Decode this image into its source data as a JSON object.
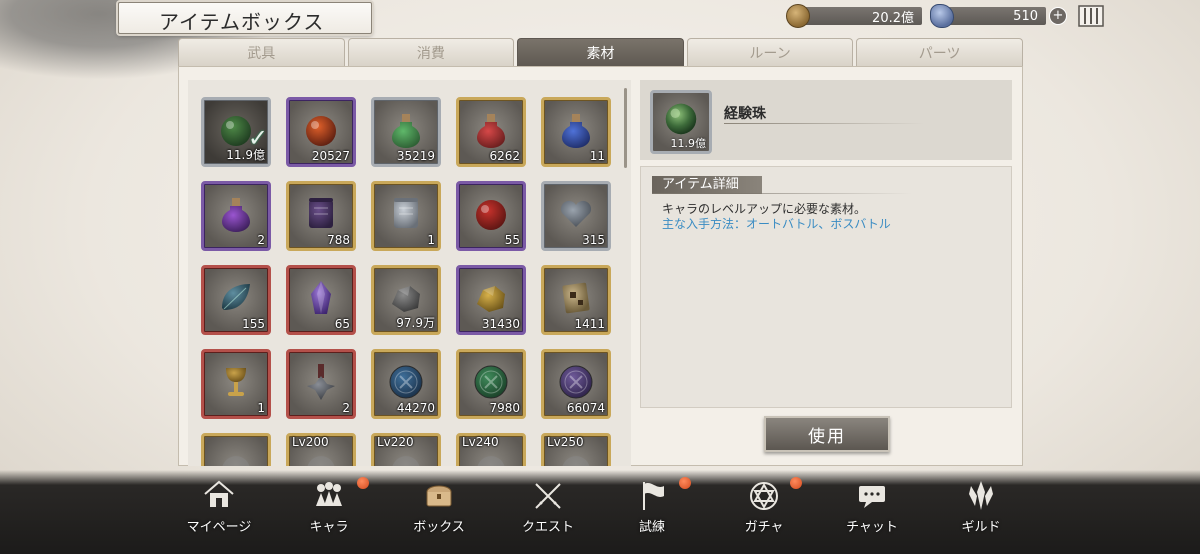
{
  "header": {
    "title": "アイテムボックス",
    "gold": "20.2億",
    "gems": "510"
  },
  "tabs": [
    {
      "label": "武具",
      "active": false
    },
    {
      "label": "消費",
      "active": false
    },
    {
      "label": "素材",
      "active": true
    },
    {
      "label": "ルーン",
      "active": false
    },
    {
      "label": "パーツ",
      "active": false
    }
  ],
  "items": [
    {
      "qty": "11.9億",
      "rarity": "grey",
      "icon": "green-orb-icon",
      "selected": true
    },
    {
      "qty": "20527",
      "rarity": "purple",
      "icon": "fire-orb-icon"
    },
    {
      "qty": "35219",
      "rarity": "grey",
      "icon": "green-potion-icon"
    },
    {
      "qty": "6262",
      "rarity": "gold",
      "icon": "red-potion-icon"
    },
    {
      "qty": "11",
      "rarity": "gold",
      "icon": "blue-potion-icon"
    },
    {
      "qty": "2",
      "rarity": "purple",
      "icon": "purple-potion-icon"
    },
    {
      "qty": "788",
      "rarity": "gold",
      "icon": "purple-scroll-icon"
    },
    {
      "qty": "1",
      "rarity": "gold",
      "icon": "tower-scroll-icon"
    },
    {
      "qty": "55",
      "rarity": "purple",
      "icon": "red-apple-icon"
    },
    {
      "qty": "315",
      "rarity": "grey",
      "icon": "heart-icon"
    },
    {
      "qty": "155",
      "rarity": "red",
      "icon": "leaf-icon"
    },
    {
      "qty": "65",
      "rarity": "red",
      "icon": "crystal-icon"
    },
    {
      "qty": "97.9万",
      "rarity": "gold",
      "icon": "ore-icon"
    },
    {
      "qty": "31430",
      "rarity": "purple",
      "icon": "gold-ore-icon"
    },
    {
      "qty": "1411",
      "rarity": "gold",
      "icon": "rune-tablet-icon"
    },
    {
      "qty": "1",
      "rarity": "red",
      "icon": "chalice-icon"
    },
    {
      "qty": "2",
      "rarity": "red",
      "icon": "medal-icon"
    },
    {
      "qty": "44270",
      "rarity": "gold",
      "icon": "blue-coin-icon"
    },
    {
      "qty": "7980",
      "rarity": "gold",
      "icon": "green-coin-icon"
    },
    {
      "qty": "66074",
      "rarity": "gold",
      "icon": "purple-coin-icon"
    },
    {
      "lv": "",
      "rarity": "gold",
      "icon": "partial-item-icon"
    },
    {
      "lv": "Lv200",
      "rarity": "gold",
      "icon": "partial-item-icon"
    },
    {
      "lv": "Lv220",
      "rarity": "gold",
      "icon": "partial-item-icon"
    },
    {
      "lv": "Lv240",
      "rarity": "gold",
      "icon": "partial-item-icon"
    },
    {
      "lv": "Lv250",
      "rarity": "gold",
      "icon": "partial-item-icon"
    }
  ],
  "detail": {
    "name": "経験珠",
    "qty": "11.9億",
    "section_title": "アイテム詳細",
    "description": "キャラのレベルアップに必要な素材。",
    "source": "主な入手方法：オートバトル、ボスバトル",
    "use_label": "使用"
  },
  "nav": [
    {
      "label": "マイページ",
      "icon": "home-icon",
      "badge": false
    },
    {
      "label": "キャラ",
      "icon": "characters-icon",
      "badge": true
    },
    {
      "label": "ボックス",
      "icon": "chest-icon",
      "badge": false
    },
    {
      "label": "クエスト",
      "icon": "crossed-swords-icon",
      "badge": false
    },
    {
      "label": "試練",
      "icon": "flag-icon",
      "badge": true
    },
    {
      "label": "ガチャ",
      "icon": "hexagram-icon",
      "badge": true
    },
    {
      "label": "チャット",
      "icon": "chat-icon",
      "badge": false
    },
    {
      "label": "ギルド",
      "icon": "guild-emblem-icon",
      "badge": false
    }
  ],
  "colors": {
    "rarity_grey": "#a7acb2",
    "rarity_purple": "#7b5aa6",
    "rarity_gold": "#c9a85a",
    "rarity_red": "#b4504a",
    "source_text": "#3a8cc3",
    "badge": "#d44a1e"
  }
}
